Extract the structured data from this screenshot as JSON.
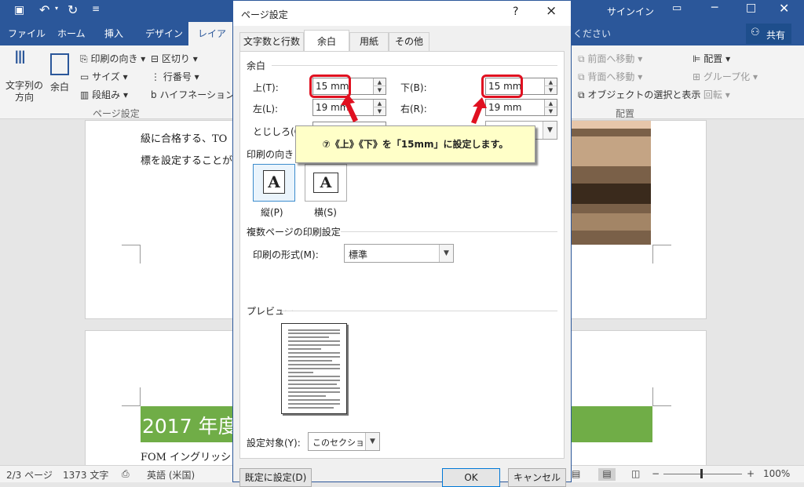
{
  "titlebar": {
    "signin": "サインイン"
  },
  "tabs": [
    "ファイル",
    "ホーム",
    "挿入",
    "デザイン",
    "レイアウト"
  ],
  "tellme": "ください",
  "share": "共有",
  "ribbon": {
    "text_direction": "文字列の方向",
    "margins": "余白",
    "orientation": "印刷の向き",
    "size": "サイズ",
    "columns": "段組み",
    "breaks": "区切り",
    "line_numbers": "行番号",
    "hyphenation": "ハイフネーション",
    "page_setup_group": "ページ設定",
    "bring_forward": "前面へ移動",
    "send_backward": "背面へ移動",
    "selection_pane": "オブジェクトの選択と表示",
    "align": "配置",
    "group": "グループ化",
    "rotate": "回転",
    "arrange_group": "配置"
  },
  "doc": {
    "line1": "級に合格する、TO",
    "line2": "標を設定することが",
    "heading": "2017 年度",
    "line3": "FOM イングリッシ"
  },
  "status": {
    "page": "2/3 ページ",
    "words": "1373 文字",
    "lang": "英語 (米国)",
    "zoom": "100%"
  },
  "dialog": {
    "title": "ページ設定",
    "help": "?",
    "close": "×",
    "tabs": [
      "文字数と行数",
      "余白",
      "用紙",
      "その他"
    ],
    "margins_section": "余白",
    "top_label": "上(T):",
    "top_value": "15 mm",
    "bottom_label": "下(B):",
    "bottom_value": "15 mm",
    "left_label": "左(L):",
    "left_value": "19 mm",
    "right_label": "右(R):",
    "right_value": "19 mm",
    "gutter_label": "とじしろ(G)",
    "orientation_section": "印刷の向き",
    "portrait": "縦(P)",
    "landscape": "横(S)",
    "multipage_section": "複数ページの印刷設定",
    "print_format_label": "印刷の形式(M):",
    "print_format_value": "標準",
    "preview_section": "プレビュー",
    "apply_to_label": "設定対象(Y):",
    "apply_to_value": "このセクション",
    "default_button": "既定に設定(D)",
    "ok_button": "OK",
    "cancel_button": "キャンセル"
  },
  "callout": {
    "text": "⑦《上》《下》を「15mm」に設定します。"
  },
  "colors": {
    "accent": "#2b579a",
    "highlight": "#e01020",
    "heading_bg": "#70ad47",
    "callout_bg": "#ffffc8"
  }
}
